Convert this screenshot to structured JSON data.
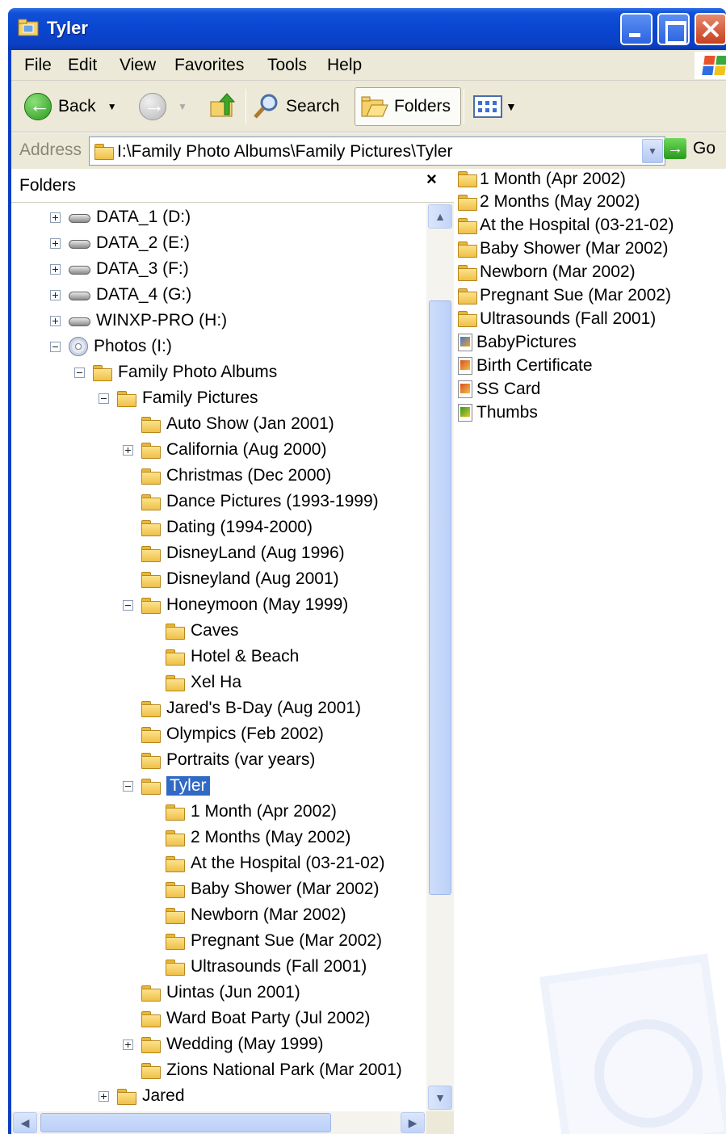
{
  "window": {
    "title": "Tyler"
  },
  "menu": [
    "File",
    "Edit",
    "View",
    "Favorites",
    "Tools",
    "Help"
  ],
  "toolbar": {
    "back_label": "Back",
    "search_label": "Search",
    "folders_label": "Folders"
  },
  "address": {
    "label": "Address",
    "path": "I:\\Family Photo Albums\\Family Pictures\\Tyler",
    "go_label": "Go"
  },
  "folders_pane": {
    "title": "Folders",
    "close_glyph": "×",
    "tree": [
      {
        "label": "DATA_1 (D:)",
        "icon": "drive-icon",
        "expander": "plus"
      },
      {
        "label": "DATA_2 (E:)",
        "icon": "drive-icon",
        "expander": "plus"
      },
      {
        "label": "DATA_3 (F:)",
        "icon": "drive-icon",
        "expander": "plus"
      },
      {
        "label": "DATA_4 (G:)",
        "icon": "drive-icon",
        "expander": "plus"
      },
      {
        "label": "WINXP-PRO (H:)",
        "icon": "drive-icon",
        "expander": "plus"
      },
      {
        "label": "Photos (I:)",
        "icon": "cd-icon",
        "expander": "minus"
      },
      {
        "label": "Family Photo Albums",
        "icon": "folder-icon",
        "expander": "minus"
      },
      {
        "label": "Family Pictures",
        "icon": "folder-icon",
        "expander": "minus"
      },
      {
        "label": "Auto Show (Jan 2001)",
        "icon": "folder-icon",
        "expander": "none"
      },
      {
        "label": "California (Aug 2000)",
        "icon": "folder-icon",
        "expander": "plus"
      },
      {
        "label": "Christmas (Dec 2000)",
        "icon": "folder-icon",
        "expander": "none"
      },
      {
        "label": "Dance Pictures (1993-1999)",
        "icon": "folder-icon",
        "expander": "none"
      },
      {
        "label": "Dating (1994-2000)",
        "icon": "folder-icon",
        "expander": "none"
      },
      {
        "label": "DisneyLand (Aug 1996)",
        "icon": "folder-icon",
        "expander": "none"
      },
      {
        "label": "Disneyland (Aug 2001)",
        "icon": "folder-icon",
        "expander": "none"
      },
      {
        "label": "Honeymoon (May 1999)",
        "icon": "folder-icon",
        "expander": "minus"
      },
      {
        "label": "Caves",
        "icon": "folder-icon",
        "expander": "none"
      },
      {
        "label": "Hotel & Beach",
        "icon": "folder-icon",
        "expander": "none"
      },
      {
        "label": "Xel Ha",
        "icon": "folder-icon",
        "expander": "none"
      },
      {
        "label": "Jared's B-Day (Aug 2001)",
        "icon": "folder-icon",
        "expander": "none"
      },
      {
        "label": "Olympics (Feb 2002)",
        "icon": "folder-icon",
        "expander": "none"
      },
      {
        "label": "Portraits (var years)",
        "icon": "folder-icon",
        "expander": "none"
      },
      {
        "label": "Tyler",
        "icon": "folder-icon",
        "expander": "minus",
        "selected": true
      },
      {
        "label": "1 Month (Apr 2002)",
        "icon": "folder-icon",
        "expander": "none"
      },
      {
        "label": "2 Months (May 2002)",
        "icon": "folder-icon",
        "expander": "none"
      },
      {
        "label": "At the Hospital (03-21-02)",
        "icon": "folder-icon",
        "expander": "none"
      },
      {
        "label": "Baby Shower (Mar 2002)",
        "icon": "folder-icon",
        "expander": "none"
      },
      {
        "label": "Newborn (Mar 2002)",
        "icon": "folder-icon",
        "expander": "none"
      },
      {
        "label": "Pregnant Sue (Mar 2002)",
        "icon": "folder-icon",
        "expander": "none"
      },
      {
        "label": "Ultrasounds (Fall 2001)",
        "icon": "folder-icon",
        "expander": "none"
      },
      {
        "label": "Uintas (Jun 2001)",
        "icon": "folder-icon",
        "expander": "none"
      },
      {
        "label": "Ward Boat Party (Jul 2002)",
        "icon": "folder-icon",
        "expander": "none"
      },
      {
        "label": "Wedding (May 1999)",
        "icon": "folder-icon",
        "expander": "plus"
      },
      {
        "label": "Zions National Park (Mar 2001)",
        "icon": "folder-icon",
        "expander": "none"
      },
      {
        "label": "Jared",
        "icon": "folder-icon",
        "expander": "plus"
      }
    ]
  },
  "content": {
    "items": [
      {
        "label": "1 Month (Apr 2002)",
        "icon": "folder-icon"
      },
      {
        "label": "2 Months (May 2002)",
        "icon": "folder-icon"
      },
      {
        "label": "At the Hospital (03-21-02)",
        "icon": "folder-icon"
      },
      {
        "label": "Baby Shower (Mar 2002)",
        "icon": "folder-icon"
      },
      {
        "label": "Newborn (Mar 2002)",
        "icon": "folder-icon"
      },
      {
        "label": "Pregnant Sue (Mar 2002)",
        "icon": "folder-icon"
      },
      {
        "label": "Ultrasounds (Fall 2001)",
        "icon": "folder-icon"
      },
      {
        "label": "BabyPictures",
        "icon": "photo-file-icon"
      },
      {
        "label": "Birth Certificate",
        "icon": "document-file-icon"
      },
      {
        "label": "SS Card",
        "icon": "document-file-icon"
      },
      {
        "label": "Thumbs",
        "icon": "thumbs-file-icon"
      }
    ]
  },
  "colors": {
    "titlebar": "#0a46d1",
    "selection": "#316ac5",
    "chrome": "#ece9d8"
  }
}
